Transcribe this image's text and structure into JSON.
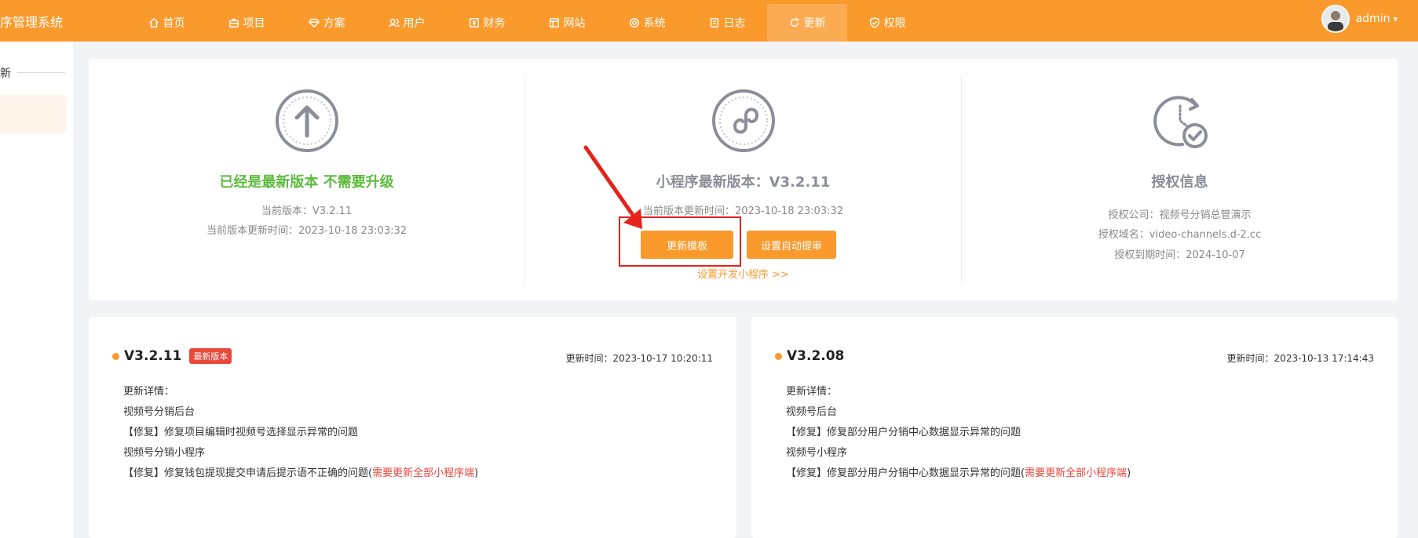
{
  "header": {
    "brand": "序管理系统",
    "nav": [
      {
        "label": "首页",
        "icon": "home-icon"
      },
      {
        "label": "项目",
        "icon": "briefcase-icon"
      },
      {
        "label": "方案",
        "icon": "diamond-icon"
      },
      {
        "label": "用户",
        "icon": "users-icon"
      },
      {
        "label": "财务",
        "icon": "finance-icon"
      },
      {
        "label": "网站",
        "icon": "website-icon"
      },
      {
        "label": "系统",
        "icon": "gear-icon"
      },
      {
        "label": "日志",
        "icon": "log-icon"
      },
      {
        "label": "更新",
        "icon": "refresh-icon",
        "active": true
      },
      {
        "label": "权限",
        "icon": "shield-icon"
      }
    ],
    "user": {
      "name": "admin"
    }
  },
  "sidebar": {
    "section_label": "新"
  },
  "status": {
    "title": "已经是最新版本 不需要升级",
    "current_version": "当前版本：V3.2.11",
    "current_update_time": "当前版本更新时间：2023-10-18 23:03:32"
  },
  "mini_program": {
    "title": "小程序最新版本：V3.2.11",
    "update_time": "当前版本更新时间：2023-10-18 23:03:32",
    "update_template_button": "更新模板",
    "auto_submit_button": "设置自动提审",
    "dev_link": "设置开发小程序 >>"
  },
  "license": {
    "title": "授权信息",
    "company": "授权公司：视频号分销总管演示",
    "domain": "授权域名：video-channels.d-2.cc",
    "expire": "授权到期时间：2024-10-07"
  },
  "changelogs": [
    {
      "version": "V3.2.11",
      "badge": "最新版本",
      "time": "更新时间：2023-10-17 10:20:11",
      "heading": "更新详情：",
      "sec1": "视频号分销后台",
      "fix1": "【修复】修复项目编辑时视频号选择显示异常的问题",
      "sec2": "视频号分销小程序",
      "fix2": "【修复】修复钱包提现提交申请后提示语不正确的问题(",
      "note": "需要更新全部小程序端",
      "close": ")"
    },
    {
      "version": "V3.2.08",
      "time": "更新时间：2023-10-13 17:14:43",
      "heading": "更新详情：",
      "sec1": "视频号后台",
      "fix1": "【修复】修复部分用户分销中心数据显示异常的问题",
      "sec2": "视频号小程序",
      "fix2": "【修复】修复部分用户分销中心数据显示异常的问题(",
      "note": "需要更新全部小程序端",
      "close": ")"
    }
  ],
  "colors": {
    "brand": "#fb9a2c",
    "success": "#5cbb3c",
    "danger": "#e5231b"
  }
}
